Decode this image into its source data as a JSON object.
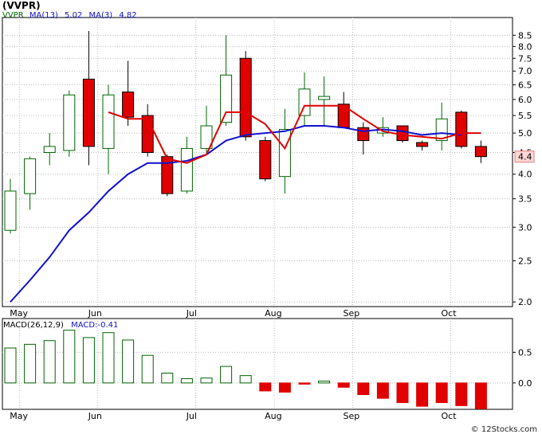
{
  "title": "(VVPR)",
  "credit": "© 12Stocks.com",
  "colors": {
    "up": "#006400",
    "down": "#e00000",
    "ma13": "#1010d0",
    "ma3": "#e00000",
    "frame": "#000000",
    "grid": "#bbbbbb"
  },
  "price_legend": {
    "symbol": "VVPR",
    "ma13_label": "MA(13)",
    "ma13_value": "5.02",
    "ma3_label": "MA(3)",
    "ma3_value": "4.82"
  },
  "macd_legend": {
    "label": "MACD(26,12,9)",
    "value_label": "MACD:-0.41"
  },
  "last_price_label": "4.4",
  "chart_data": [
    {
      "type": "candlestick",
      "title": "(VVPR)",
      "y_scale": "log",
      "ylim": [
        1.95,
        9.2
      ],
      "y_ticks": [
        "2.0",
        "2.5",
        "3.0",
        "3.5",
        "4.0",
        "4.5",
        "5.0",
        "5.5",
        "6.0",
        "6.5",
        "7.0",
        "7.5",
        "8.0",
        "8.5"
      ],
      "x_labels": [
        "May",
        "Jun",
        "Jul",
        "Aug",
        "Sep",
        "Oct"
      ],
      "month_start_index": [
        1,
        5,
        10,
        14,
        18,
        23
      ],
      "candles": [
        {
          "o": 2.95,
          "h": 3.9,
          "l": 2.9,
          "c": 3.65
        },
        {
          "o": 3.6,
          "h": 4.4,
          "l": 3.3,
          "c": 4.35
        },
        {
          "o": 4.5,
          "h": 5.0,
          "l": 4.2,
          "c": 4.65
        },
        {
          "o": 4.55,
          "h": 6.3,
          "l": 4.4,
          "c": 6.15
        },
        {
          "o": 6.7,
          "h": 8.7,
          "l": 4.2,
          "c": 4.65
        },
        {
          "o": 4.6,
          "h": 6.5,
          "l": 4.0,
          "c": 6.15
        },
        {
          "o": 6.25,
          "h": 7.4,
          "l": 5.2,
          "c": 5.45
        },
        {
          "o": 5.5,
          "h": 5.85,
          "l": 4.4,
          "c": 4.5
        },
        {
          "o": 4.4,
          "h": 4.45,
          "l": 3.55,
          "c": 3.6
        },
        {
          "o": 3.65,
          "h": 4.9,
          "l": 3.6,
          "c": 4.6
        },
        {
          "o": 4.6,
          "h": 5.8,
          "l": 4.5,
          "c": 5.2
        },
        {
          "o": 5.3,
          "h": 8.5,
          "l": 5.2,
          "c": 6.85
        },
        {
          "o": 7.5,
          "h": 7.8,
          "l": 4.8,
          "c": 4.9
        },
        {
          "o": 4.8,
          "h": 4.9,
          "l": 3.85,
          "c": 3.9
        },
        {
          "o": 3.95,
          "h": 5.7,
          "l": 3.6,
          "c": 5.1
        },
        {
          "o": 5.5,
          "h": 6.95,
          "l": 5.2,
          "c": 6.35
        },
        {
          "o": 6.0,
          "h": 6.8,
          "l": 5.2,
          "c": 6.1
        },
        {
          "o": 5.85,
          "h": 6.25,
          "l": 5.15,
          "c": 5.15
        },
        {
          "o": 5.15,
          "h": 5.3,
          "l": 4.45,
          "c": 4.8
        },
        {
          "o": 5.0,
          "h": 5.45,
          "l": 4.9,
          "c": 5.15
        },
        {
          "o": 5.2,
          "h": 5.2,
          "l": 4.75,
          "c": 4.8
        },
        {
          "o": 4.75,
          "h": 4.8,
          "l": 4.55,
          "c": 4.65
        },
        {
          "o": 4.8,
          "h": 5.9,
          "l": 4.55,
          "c": 5.4
        },
        {
          "o": 5.6,
          "h": 5.65,
          "l": 4.6,
          "c": 4.65
        },
        {
          "o": 4.65,
          "h": 4.8,
          "l": 4.25,
          "c": 4.4
        }
      ],
      "series": [
        {
          "name": "MA(13)",
          "values": [
            2.0,
            2.25,
            2.55,
            2.95,
            3.25,
            3.65,
            4.0,
            4.25,
            4.25,
            4.3,
            4.45,
            4.8,
            4.95,
            5.0,
            5.05,
            5.2,
            5.2,
            5.15,
            5.05,
            5.1,
            5.05,
            4.95,
            5.0,
            4.95
          ]
        },
        {
          "name": "MA(3)",
          "values": [
            null,
            null,
            null,
            null,
            null,
            5.6,
            5.4,
            5.4,
            4.35,
            4.25,
            4.45,
            5.6,
            5.6,
            5.25,
            4.6,
            5.8,
            5.8,
            5.8,
            5.4,
            5.05,
            4.95,
            4.9,
            4.85,
            5.0,
            5.0
          ]
        }
      ]
    },
    {
      "type": "bar",
      "title": "MACD(26,12,9)",
      "ylim": [
        -0.43,
        1.05
      ],
      "y_ticks": [
        "0.5",
        "0.0"
      ],
      "x_labels": [
        "May",
        "Jun",
        "Jul",
        "Aug",
        "Sep",
        "Oct"
      ],
      "values": [
        0.57,
        0.63,
        0.69,
        0.86,
        0.74,
        0.82,
        0.7,
        0.45,
        0.16,
        0.07,
        0.08,
        0.27,
        0.12,
        -0.13,
        -0.15,
        -0.01,
        0.03,
        -0.07,
        -0.19,
        -0.25,
        -0.32,
        -0.38,
        -0.32,
        -0.37,
        -0.42
      ]
    }
  ]
}
